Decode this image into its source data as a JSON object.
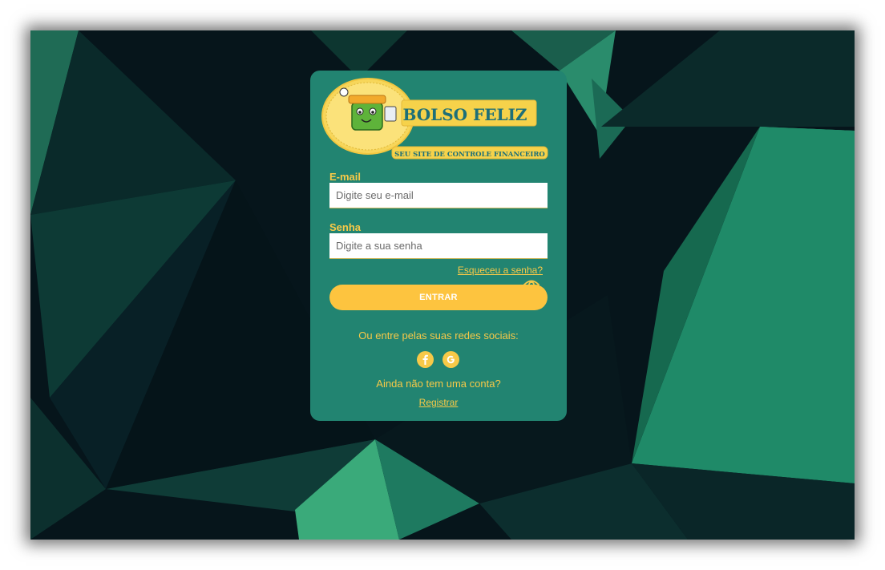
{
  "brand": {
    "title": "BOLSO FELIZ",
    "tagline": "SEU SITE DE CONTROLE FINANCEIRO"
  },
  "form": {
    "email_label": "E-mail",
    "email_placeholder": "Digite seu e-mail",
    "password_label": "Senha",
    "password_placeholder": "Digite a sua senha",
    "forgot_link": "Esqueceu a senha?",
    "submit_label": "ENTRAR"
  },
  "social": {
    "prompt": "Ou entre pelas suas redes sociais:",
    "icons": [
      "facebook-icon",
      "google-icon"
    ]
  },
  "signup": {
    "prompt": "Ainda não tem uma conta?",
    "link": "Registrar"
  },
  "colors": {
    "card": "#228471",
    "accent": "#f7c948",
    "button": "#fdc43f",
    "background": "#06141a"
  }
}
